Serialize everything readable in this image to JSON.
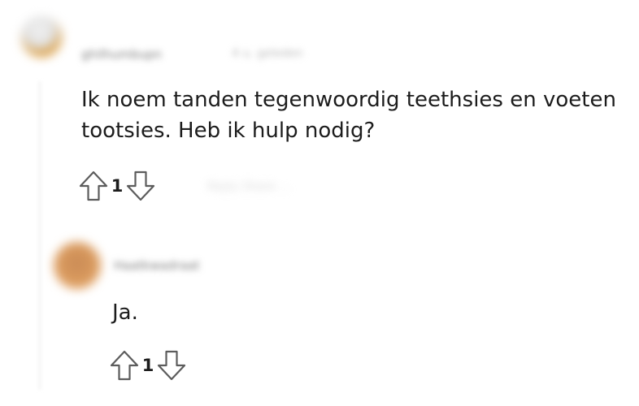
{
  "comments": [
    {
      "username": "ghilhumbupn",
      "meta": "4 u. geleden",
      "text_line1": "Ik noem tanden tegenwoordig teethsies en voeten",
      "text_line2": "tootsies. Heb ik hulp nodig?",
      "score": "1",
      "actions": "Reply   Share   ...",
      "avatar_color": "#e9e9e9",
      "avatar_accent": "#d7932a",
      "upvote_icon": "arrow-up-outline",
      "downvote_icon": "arrow-down-outline"
    },
    {
      "username": "Haatkwadraat",
      "text": "Ja.",
      "score": "1",
      "avatar_color": "#d99a5e",
      "upvote_icon": "arrow-up-outline",
      "downvote_icon": "arrow-down-outline"
    }
  ],
  "colors": {
    "text": "#1c1c1c",
    "icon_stroke": "#5c5c5c",
    "muted": "#7c7c7c"
  }
}
